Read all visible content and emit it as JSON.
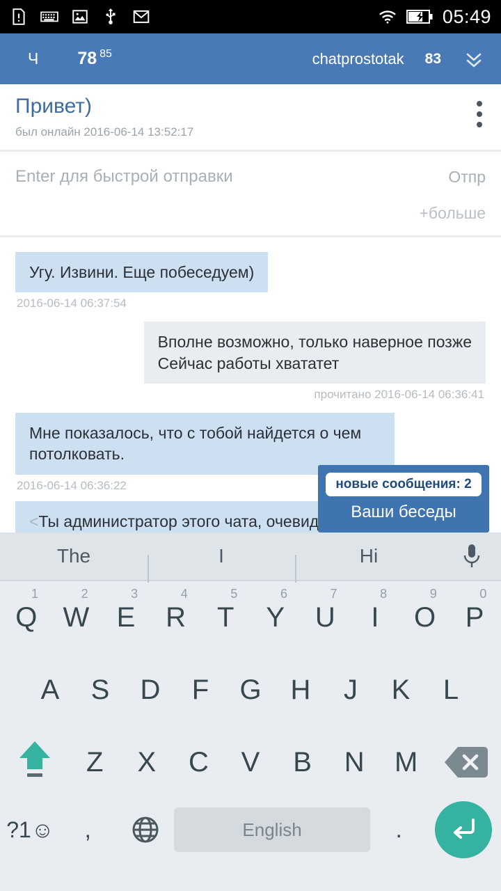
{
  "statusbar": {
    "icons": [
      "sdcard-warning-icon",
      "keyboard-icon",
      "image-icon",
      "usb-icon",
      "gmail-icon"
    ],
    "wifi_icon": "wifi-icon",
    "battery_icon": "battery-charging-icon",
    "clock": "05:49"
  },
  "appbar": {
    "logo": "Ч",
    "counter_main": "78",
    "counter_sup": "85",
    "username": "chatprostotak",
    "badge": "83",
    "expand_icon": "double-chevron-down-icon",
    "bg_color": "#4a7ab5"
  },
  "chat_header": {
    "title": "Привет)",
    "status": "был онлайн 2016-06-14 13:52:17",
    "menu_icon": "kebab-menu-icon"
  },
  "composer": {
    "placeholder": "Enter для быстрой отправки",
    "value": "",
    "send_label": "Отпр",
    "more_label": "+больше"
  },
  "messages": [
    {
      "direction": "in",
      "text": "Угу. Извини. Еще побеседуем)",
      "meta": "2016-06-14 06:37:54"
    },
    {
      "direction": "out",
      "text": "Вполне возможно, только наверное позже Сейчас работы хвататет",
      "meta": "прочитано 2016-06-14 06:36:41"
    },
    {
      "direction": "in",
      "text": "Мне показалось, что с тобой найдется о чем потолковать.",
      "meta": "2016-06-14 06:36:22"
    },
    {
      "direction": "in",
      "text": "Ты администратор этого чата, очевидно",
      "meta": ""
    }
  ],
  "overlay": {
    "badge": "новые сообщения: 2",
    "label": "Ваши беседы",
    "bg_color": "#3f74b0"
  },
  "keyboard": {
    "suggestions": [
      "The",
      "I",
      "Hi"
    ],
    "mic_icon": "microphone-icon",
    "row1": [
      {
        "letter": "Q",
        "num": "1"
      },
      {
        "letter": "W",
        "num": "2"
      },
      {
        "letter": "E",
        "num": "3"
      },
      {
        "letter": "R",
        "num": "4"
      },
      {
        "letter": "T",
        "num": "5"
      },
      {
        "letter": "Y",
        "num": "6"
      },
      {
        "letter": "U",
        "num": "7"
      },
      {
        "letter": "I",
        "num": "8"
      },
      {
        "letter": "O",
        "num": "9"
      },
      {
        "letter": "P",
        "num": "0"
      }
    ],
    "row2": [
      "A",
      "S",
      "D",
      "F",
      "G",
      "H",
      "J",
      "K",
      "L"
    ],
    "row3": [
      "Z",
      "X",
      "C",
      "V",
      "B",
      "N",
      "M"
    ],
    "shift_icon": "shift-up-arrow-icon",
    "backspace_icon": "backspace-delete-icon",
    "symbols_label": "?1☺",
    "comma_label": ",",
    "globe_icon": "globe-language-icon",
    "space_label": "English",
    "period_label": ".",
    "enter_icon": "enter-return-icon",
    "accent_color": "#36b3a0"
  }
}
